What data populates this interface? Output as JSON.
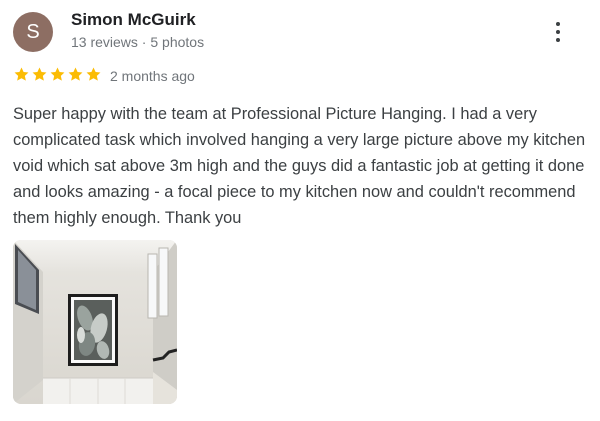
{
  "reviewer": {
    "initial": "S",
    "name": "Simon McGuirk",
    "meta": "13 reviews · 5 photos",
    "avatar_color": "#8d6e63"
  },
  "rating": {
    "stars": 5,
    "max": 5,
    "star_color": "#fbbc04",
    "date": "2 months ago"
  },
  "review_text": "Super happy with the team at Professional Picture Hanging. I had a very complicated task which involved hanging a very large picture above my kitchen void which sat above 3m high and the guys did a fantastic job at getting it done and looks amazing - a focal piece to my kitchen now and couldn't recommend them highly enough. Thank you",
  "more_menu_icon": "more-vert-icon",
  "photos": [
    {
      "subject": "framed botanical print hanging on tall wall above kitchen"
    }
  ]
}
